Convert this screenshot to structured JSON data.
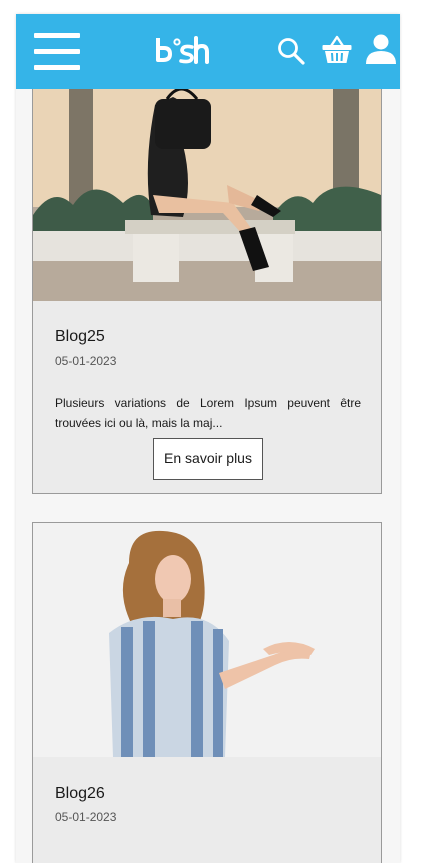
{
  "header": {
    "brand": "b°sh",
    "bg_color": "#35b4e8",
    "icons": [
      "menu-icon",
      "search-icon",
      "basket-icon",
      "user-icon"
    ]
  },
  "posts": [
    {
      "title": "Blog25",
      "date": "05-01-2023",
      "excerpt": "Plusieurs variations de Lorem Ipsum peuvent être trouvées ici ou là, mais la maj...",
      "button": "En savoir plus"
    },
    {
      "title": "Blog26",
      "date": "05-01-2023"
    }
  ]
}
